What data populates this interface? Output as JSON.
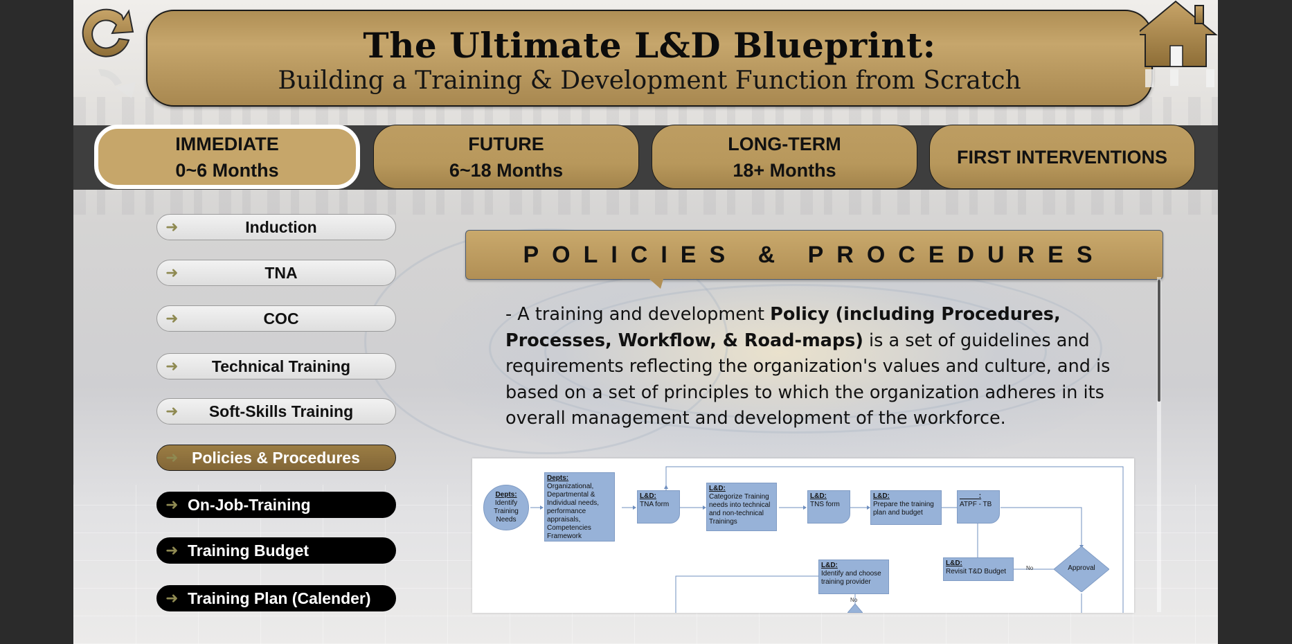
{
  "header": {
    "title": "The Ultimate L&D Blueprint:",
    "subtitle": "Building a Training & Development Function from Scratch"
  },
  "icons": {
    "refresh": "refresh-icon",
    "home": "home-icon",
    "arrow": "arrow-right-icon"
  },
  "tabs": [
    {
      "line1": "IMMEDIATE",
      "line2": "0~6 Months",
      "active": true
    },
    {
      "line1": "FUTURE",
      "line2": "6~18 Months",
      "active": false
    },
    {
      "line1": "LONG-TERM",
      "line2": "18+ Months",
      "active": false
    },
    {
      "line1": "FIRST INTERVENTIONS",
      "line2": "",
      "active": false
    }
  ],
  "sidebar": {
    "items": [
      {
        "label": "Induction",
        "style": "light"
      },
      {
        "label": "TNA",
        "style": "light"
      },
      {
        "label": "COC",
        "style": "light"
      },
      {
        "label": "Technical Training",
        "style": "light"
      },
      {
        "label": "Soft-Skills Training",
        "style": "light"
      },
      {
        "label": "Policies & Procedures",
        "style": "selected"
      },
      {
        "label": "On-Job-Training",
        "style": "dark"
      },
      {
        "label": "Training Budget",
        "style": "dark"
      },
      {
        "label": "Training Plan (Calender)",
        "style": "dark"
      }
    ]
  },
  "section": {
    "title": "POLICIES & PROCEDURES",
    "desc_pre": "- A training and development ",
    "desc_bold": "Policy (including Procedures, Processes, Workflow, & Road-maps)",
    "desc_post": " is a set of guidelines and requirements reflecting the organization's values and culture, and is based on a set of principles to which the organization adheres in its overall management and development of the workforce."
  },
  "flowchart": {
    "start": {
      "head": "Depts:",
      "lines": [
        "Identify",
        "Training",
        "Needs"
      ]
    },
    "needs": {
      "head": "Depts:",
      "text": "Organizational, Departmental & Individual needs, performance appraisals, Competencies Framework"
    },
    "tna": {
      "head": "L&D:",
      "text": "TNA form"
    },
    "categorize": {
      "head": "L&D:",
      "text": "Categorize Training needs into technical and non-technical Trainings"
    },
    "tns": {
      "head": "L&D:",
      "text": "TNS form"
    },
    "prepare": {
      "head": "L&D:",
      "text": "Prepare the training plan and budget"
    },
    "atpf": {
      "head": "_____:",
      "text": "ATPF - TB"
    },
    "approval": "Approval",
    "revisit": {
      "head": "L&D:",
      "text": "Revisit T&D Budget"
    },
    "provider": {
      "head": "L&D:",
      "text": "Identify and choose training provider"
    },
    "no1": "No",
    "no2": "No"
  }
}
